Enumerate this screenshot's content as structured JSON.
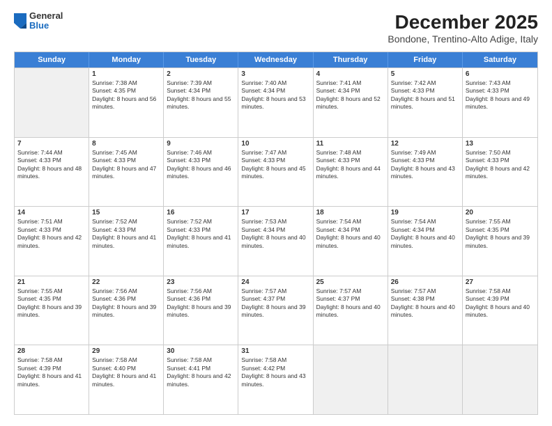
{
  "header": {
    "logo": {
      "general": "General",
      "blue": "Blue"
    },
    "title": "December 2025",
    "subtitle": "Bondone, Trentino-Alto Adige, Italy"
  },
  "calendar": {
    "days": [
      "Sunday",
      "Monday",
      "Tuesday",
      "Wednesday",
      "Thursday",
      "Friday",
      "Saturday"
    ],
    "weeks": [
      [
        {
          "day": "",
          "empty": true
        },
        {
          "day": "1",
          "sunrise": "7:38 AM",
          "sunset": "4:35 PM",
          "daylight": "8 hours and 56 minutes."
        },
        {
          "day": "2",
          "sunrise": "7:39 AM",
          "sunset": "4:34 PM",
          "daylight": "8 hours and 55 minutes."
        },
        {
          "day": "3",
          "sunrise": "7:40 AM",
          "sunset": "4:34 PM",
          "daylight": "8 hours and 53 minutes."
        },
        {
          "day": "4",
          "sunrise": "7:41 AM",
          "sunset": "4:34 PM",
          "daylight": "8 hours and 52 minutes."
        },
        {
          "day": "5",
          "sunrise": "7:42 AM",
          "sunset": "4:33 PM",
          "daylight": "8 hours and 51 minutes."
        },
        {
          "day": "6",
          "sunrise": "7:43 AM",
          "sunset": "4:33 PM",
          "daylight": "8 hours and 49 minutes."
        }
      ],
      [
        {
          "day": "7",
          "sunrise": "7:44 AM",
          "sunset": "4:33 PM",
          "daylight": "8 hours and 48 minutes."
        },
        {
          "day": "8",
          "sunrise": "7:45 AM",
          "sunset": "4:33 PM",
          "daylight": "8 hours and 47 minutes."
        },
        {
          "day": "9",
          "sunrise": "7:46 AM",
          "sunset": "4:33 PM",
          "daylight": "8 hours and 46 minutes."
        },
        {
          "day": "10",
          "sunrise": "7:47 AM",
          "sunset": "4:33 PM",
          "daylight": "8 hours and 45 minutes."
        },
        {
          "day": "11",
          "sunrise": "7:48 AM",
          "sunset": "4:33 PM",
          "daylight": "8 hours and 44 minutes."
        },
        {
          "day": "12",
          "sunrise": "7:49 AM",
          "sunset": "4:33 PM",
          "daylight": "8 hours and 43 minutes."
        },
        {
          "day": "13",
          "sunrise": "7:50 AM",
          "sunset": "4:33 PM",
          "daylight": "8 hours and 42 minutes."
        }
      ],
      [
        {
          "day": "14",
          "sunrise": "7:51 AM",
          "sunset": "4:33 PM",
          "daylight": "8 hours and 42 minutes."
        },
        {
          "day": "15",
          "sunrise": "7:52 AM",
          "sunset": "4:33 PM",
          "daylight": "8 hours and 41 minutes."
        },
        {
          "day": "16",
          "sunrise": "7:52 AM",
          "sunset": "4:33 PM",
          "daylight": "8 hours and 41 minutes."
        },
        {
          "day": "17",
          "sunrise": "7:53 AM",
          "sunset": "4:34 PM",
          "daylight": "8 hours and 40 minutes."
        },
        {
          "day": "18",
          "sunrise": "7:54 AM",
          "sunset": "4:34 PM",
          "daylight": "8 hours and 40 minutes."
        },
        {
          "day": "19",
          "sunrise": "7:54 AM",
          "sunset": "4:34 PM",
          "daylight": "8 hours and 40 minutes."
        },
        {
          "day": "20",
          "sunrise": "7:55 AM",
          "sunset": "4:35 PM",
          "daylight": "8 hours and 39 minutes."
        }
      ],
      [
        {
          "day": "21",
          "sunrise": "7:55 AM",
          "sunset": "4:35 PM",
          "daylight": "8 hours and 39 minutes."
        },
        {
          "day": "22",
          "sunrise": "7:56 AM",
          "sunset": "4:36 PM",
          "daylight": "8 hours and 39 minutes."
        },
        {
          "day": "23",
          "sunrise": "7:56 AM",
          "sunset": "4:36 PM",
          "daylight": "8 hours and 39 minutes."
        },
        {
          "day": "24",
          "sunrise": "7:57 AM",
          "sunset": "4:37 PM",
          "daylight": "8 hours and 39 minutes."
        },
        {
          "day": "25",
          "sunrise": "7:57 AM",
          "sunset": "4:37 PM",
          "daylight": "8 hours and 40 minutes."
        },
        {
          "day": "26",
          "sunrise": "7:57 AM",
          "sunset": "4:38 PM",
          "daylight": "8 hours and 40 minutes."
        },
        {
          "day": "27",
          "sunrise": "7:58 AM",
          "sunset": "4:39 PM",
          "daylight": "8 hours and 40 minutes."
        }
      ],
      [
        {
          "day": "28",
          "sunrise": "7:58 AM",
          "sunset": "4:39 PM",
          "daylight": "8 hours and 41 minutes."
        },
        {
          "day": "29",
          "sunrise": "7:58 AM",
          "sunset": "4:40 PM",
          "daylight": "8 hours and 41 minutes."
        },
        {
          "day": "30",
          "sunrise": "7:58 AM",
          "sunset": "4:41 PM",
          "daylight": "8 hours and 42 minutes."
        },
        {
          "day": "31",
          "sunrise": "7:58 AM",
          "sunset": "4:42 PM",
          "daylight": "8 hours and 43 minutes."
        },
        {
          "day": "",
          "empty": true
        },
        {
          "day": "",
          "empty": true
        },
        {
          "day": "",
          "empty": true
        }
      ]
    ]
  }
}
